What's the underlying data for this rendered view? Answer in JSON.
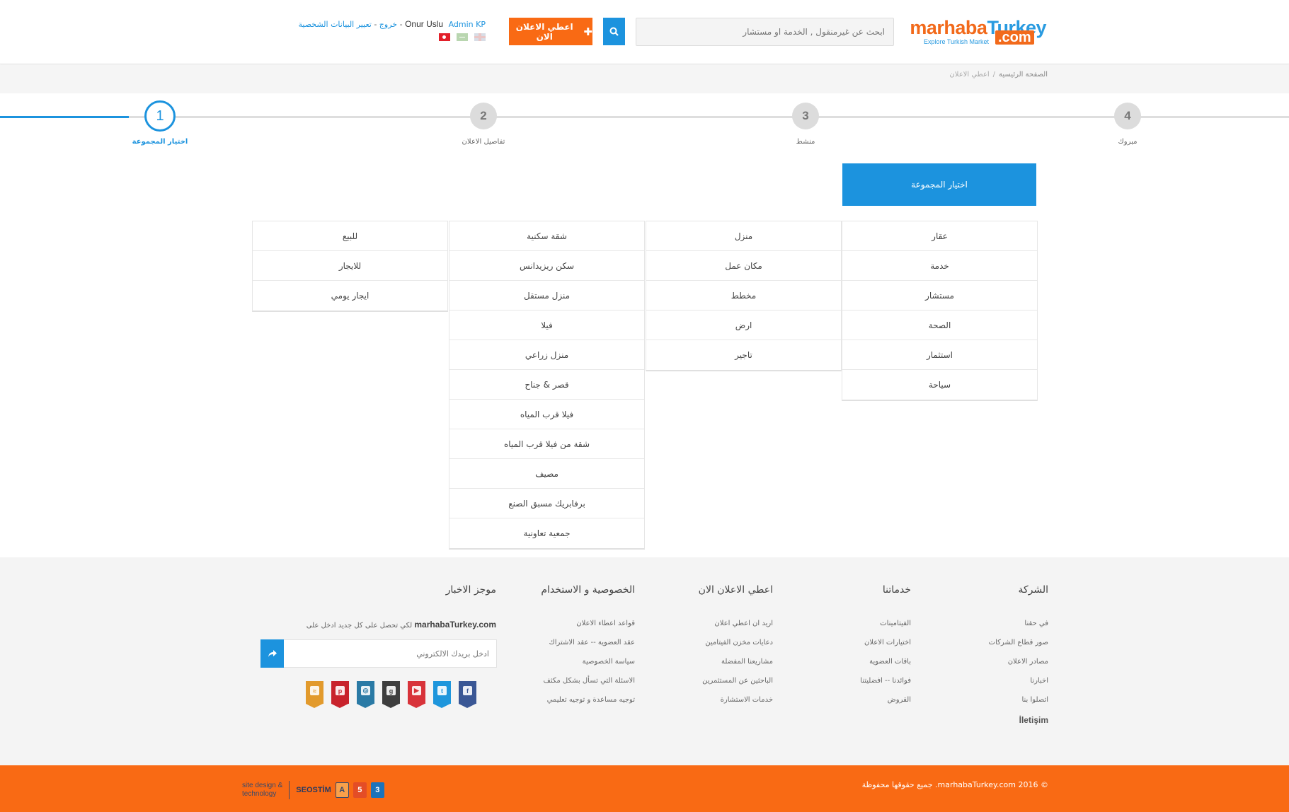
{
  "header": {
    "logo": {
      "part1": "marhaba",
      "part2": "Turkey",
      "com": ".com",
      "tagline": "Explore Turkish Market"
    },
    "search_placeholder": "ابحث عن غيرمنقول , الخدمة او مستشار",
    "post_ad_label": "اعطي الاعلان الان",
    "user": {
      "admin_label": "Admin KP",
      "name": "Onur Uslu",
      "dash": " - ",
      "edit_profile": "تعيير البيانات الشخصية",
      "logout": "خروج"
    }
  },
  "breadcrumb": {
    "home": "الصفحة الرئيسية",
    "separator": "/",
    "current": "اعطي الاعلان"
  },
  "steps": [
    {
      "number": "1",
      "label": "اختيار المجموعة"
    },
    {
      "number": "2",
      "label": "تفاصيل الاعلان"
    },
    {
      "number": "3",
      "label": "منشط"
    },
    {
      "number": "4",
      "label": "مبروك"
    }
  ],
  "group_heading": "اختيار المجموعة",
  "categories": {
    "col1": [
      "عقار",
      "خدمة",
      "مستشار",
      "الصحة",
      "استثمار",
      "سياحة"
    ],
    "col2": [
      "منزل",
      "مكان عمل",
      "مخطط",
      "ارض",
      "تاجير"
    ],
    "col3": [
      "شقة سكنية",
      "سكن ريزيدانس",
      "منزل مستقل",
      "فيلا",
      "منزل زراعي",
      "قصر & جناح",
      "فيلا قرب المياه",
      "شقة من فيلا قرب المياه",
      "مصيف",
      "برفابريك مسبق الصنع",
      "جمعية تعاونية"
    ],
    "col4": [
      "للبيع",
      "للايجار",
      "ايجار يومي"
    ]
  },
  "footer": {
    "company": {
      "title": "الشركة",
      "items": [
        "في حقنا",
        "صور قطاع الشركات",
        "مصادر الاعلان",
        "اخبارنا",
        "اتصلوا بنا"
      ],
      "extra": "İletişim"
    },
    "services": {
      "title": "خدماتنا",
      "items": [
        "الفيتامينات",
        "اختيارات الاعلان",
        "باقات العضوية",
        "فوائدنا -- افضليتنا",
        "القروض"
      ]
    },
    "post_ad": {
      "title": "اعطي الاعلان الان",
      "items": [
        "اريد ان اعطي اعلان",
        "دعايات مخزن الفيتامين",
        "مشاريعنا المفضلة",
        "الباحثين عن المستثمرين",
        "خدمات الاستشارة"
      ]
    },
    "privacy": {
      "title": "الخصوصية و الاستخدام",
      "items": [
        "قواعد اعطاء الاعلان",
        "عقد العضوية -- عقد الاشتراك",
        "سياسة الخصوصية",
        "الاسئلة التي تسأل بشكل مكثف",
        "توجيه مساعدة و توجيه تعليمي"
      ]
    },
    "news": {
      "title": "موجز الاخبار",
      "site": "marhabaTurkey.com",
      "text": "لكي تحصل على كل جديد ادخل على",
      "email_placeholder": "ادخل بريدك الالكتروني"
    }
  },
  "bottom": {
    "copyright": "© 2016 marhabaTurkey.com. جميع حقوقها محفوظة",
    "credit_line1": "site design &",
    "credit_line2": "technology",
    "credit_brand": "SEOSTİM",
    "badges": [
      "A",
      "5",
      "3"
    ]
  },
  "social_icons": [
    {
      "name": "facebook-icon",
      "color": "#3a5795",
      "glyph": "f"
    },
    {
      "name": "twitter-icon",
      "color": "#1e96dc",
      "glyph": "t"
    },
    {
      "name": "youtube-icon",
      "color": "#d8333a",
      "glyph": "▶"
    },
    {
      "name": "google-plus-icon",
      "color": "#3e3e3e",
      "glyph": "g"
    },
    {
      "name": "instagram-icon",
      "color": "#2a7aa5",
      "glyph": "◎"
    },
    {
      "name": "pinterest-icon",
      "color": "#c8232c",
      "glyph": "p"
    },
    {
      "name": "rss-icon",
      "color": "#e29a2c",
      "glyph": "≈"
    }
  ],
  "colors": {
    "primary": "#1c93de",
    "accent": "#f96a14"
  }
}
